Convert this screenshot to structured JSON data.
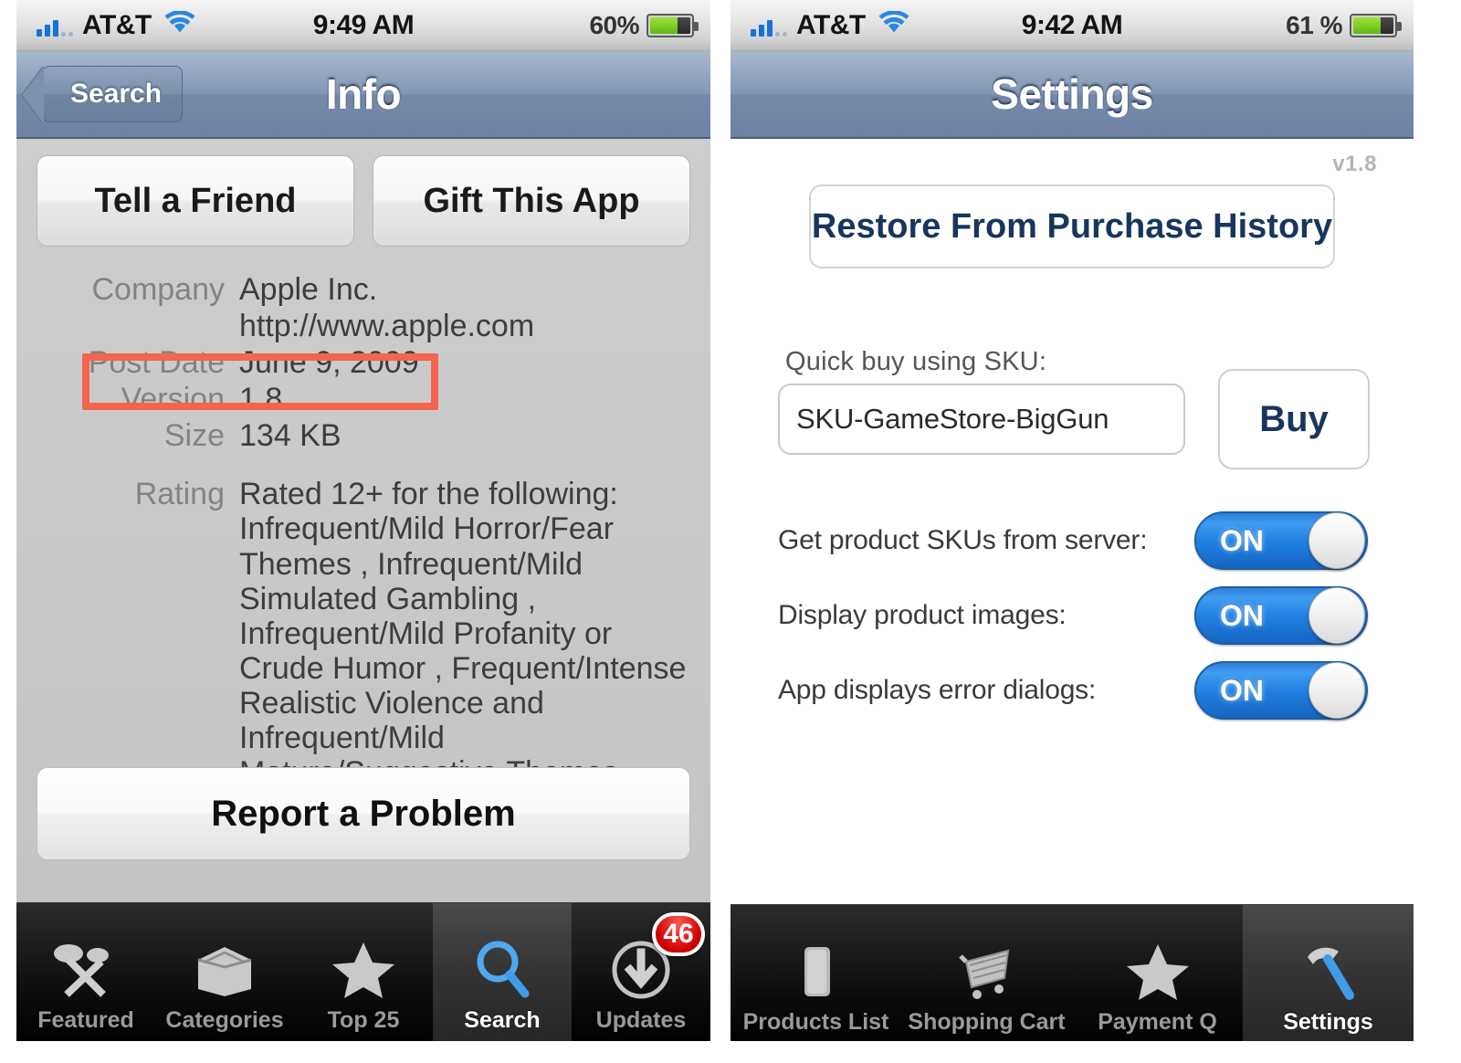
{
  "left_phone": {
    "status_bar": {
      "carrier": "AT&T",
      "time": "9:49 AM",
      "battery_percent": "60%",
      "signal_icon": "signal-bars-icon",
      "wifi_icon": "wifi-icon",
      "battery_icon": "battery-icon"
    },
    "nav": {
      "back_label": "Search",
      "title": "Info"
    },
    "buttons": {
      "tell_a_friend": "Tell a Friend",
      "gift_this_app": "Gift This App",
      "report_a_problem": "Report a Problem"
    },
    "info_rows": [
      {
        "label": "Company",
        "value": "Apple Inc."
      },
      {
        "label": "",
        "value": "http://www.apple.com"
      },
      {
        "label": "Post Date",
        "value": "June 9, 2009"
      },
      {
        "label": "Version",
        "value": "1.8"
      },
      {
        "label": "Size",
        "value": "134 KB"
      }
    ],
    "rating": {
      "label": "Rating",
      "value": "Rated 12+ for the following: Infrequent/Mild Horror/Fear Themes , Infrequent/Mild Simulated Gambling , Infrequent/Mild Profanity or Crude Humor , Frequent/Intense Realistic Violence and Infrequent/Mild Mature/Suggestive Themes"
    },
    "highlight": {
      "color": "#f4644e",
      "target": "Post Date June 9, 2009"
    },
    "tabs": [
      {
        "label": "Featured",
        "icon": "spotlights-icon",
        "selected": false,
        "badge": ""
      },
      {
        "label": "Categories",
        "icon": "box-icon",
        "selected": false,
        "badge": ""
      },
      {
        "label": "Top 25",
        "icon": "star-icon",
        "selected": false,
        "badge": ""
      },
      {
        "label": "Search",
        "icon": "magnifier-icon",
        "selected": true,
        "badge": ""
      },
      {
        "label": "Updates",
        "icon": "download-arrow-icon",
        "selected": false,
        "badge": "46"
      }
    ]
  },
  "right_phone": {
    "status_bar": {
      "carrier": "AT&T",
      "time": "9:42 AM",
      "battery_percent": "61 %",
      "signal_icon": "signal-bars-icon",
      "wifi_icon": "wifi-icon",
      "battery_icon": "battery-icon"
    },
    "nav": {
      "title": "Settings"
    },
    "version_tag": "v1.8",
    "restore_button": "Restore From Purchase History",
    "sku": {
      "label": "Quick buy using SKU:",
      "value": "SKU-GameStore-BigGun",
      "placeholder": "SKU-GameStore-BigGun",
      "buy_label": "Buy"
    },
    "toggles": [
      {
        "label": "Get product SKUs from server:",
        "state": "ON"
      },
      {
        "label": "Display product images:",
        "state": "ON"
      },
      {
        "label": "App displays error dialogs:",
        "state": "ON"
      }
    ],
    "tabs": [
      {
        "label": "Products List",
        "icon": "document-icon",
        "selected": false
      },
      {
        "label": "Shopping Cart",
        "icon": "shopping-cart-icon",
        "selected": false
      },
      {
        "label": "Payment Q",
        "icon": "star-icon",
        "selected": false
      },
      {
        "label": "Settings",
        "icon": "hammer-icon",
        "selected": true
      }
    ]
  },
  "colors": {
    "highlight_red": "#f4644e",
    "nav_blue": "#7689a9",
    "toggle_blue": "#1f7ee0",
    "badge_red": "#cc0000",
    "link_navy": "#17365d"
  }
}
